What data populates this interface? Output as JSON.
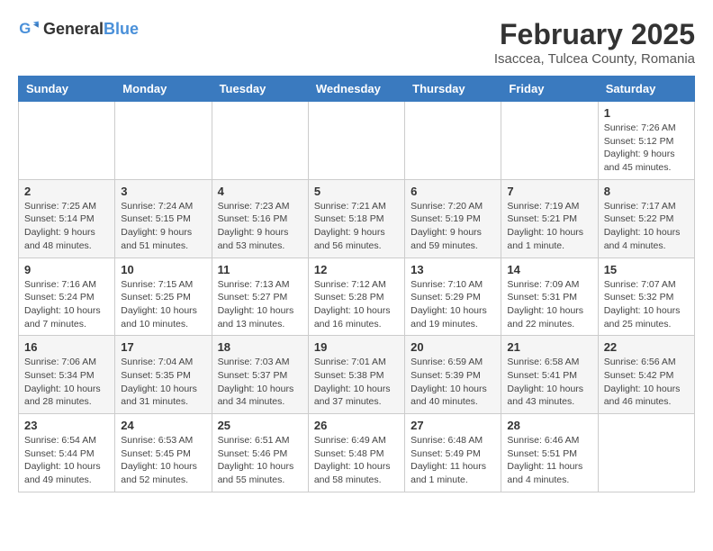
{
  "app": {
    "logo_general": "General",
    "logo_blue": "Blue"
  },
  "header": {
    "title": "February 2025",
    "subtitle": "Isaccea, Tulcea County, Romania"
  },
  "calendar": {
    "weekdays": [
      "Sunday",
      "Monday",
      "Tuesday",
      "Wednesday",
      "Thursday",
      "Friday",
      "Saturday"
    ],
    "weeks": [
      [
        {
          "day": "",
          "info": ""
        },
        {
          "day": "",
          "info": ""
        },
        {
          "day": "",
          "info": ""
        },
        {
          "day": "",
          "info": ""
        },
        {
          "day": "",
          "info": ""
        },
        {
          "day": "",
          "info": ""
        },
        {
          "day": "1",
          "info": "Sunrise: 7:26 AM\nSunset: 5:12 PM\nDaylight: 9 hours and 45 minutes."
        }
      ],
      [
        {
          "day": "2",
          "info": "Sunrise: 7:25 AM\nSunset: 5:14 PM\nDaylight: 9 hours and 48 minutes."
        },
        {
          "day": "3",
          "info": "Sunrise: 7:24 AM\nSunset: 5:15 PM\nDaylight: 9 hours and 51 minutes."
        },
        {
          "day": "4",
          "info": "Sunrise: 7:23 AM\nSunset: 5:16 PM\nDaylight: 9 hours and 53 minutes."
        },
        {
          "day": "5",
          "info": "Sunrise: 7:21 AM\nSunset: 5:18 PM\nDaylight: 9 hours and 56 minutes."
        },
        {
          "day": "6",
          "info": "Sunrise: 7:20 AM\nSunset: 5:19 PM\nDaylight: 9 hours and 59 minutes."
        },
        {
          "day": "7",
          "info": "Sunrise: 7:19 AM\nSunset: 5:21 PM\nDaylight: 10 hours and 1 minute."
        },
        {
          "day": "8",
          "info": "Sunrise: 7:17 AM\nSunset: 5:22 PM\nDaylight: 10 hours and 4 minutes."
        }
      ],
      [
        {
          "day": "9",
          "info": "Sunrise: 7:16 AM\nSunset: 5:24 PM\nDaylight: 10 hours and 7 minutes."
        },
        {
          "day": "10",
          "info": "Sunrise: 7:15 AM\nSunset: 5:25 PM\nDaylight: 10 hours and 10 minutes."
        },
        {
          "day": "11",
          "info": "Sunrise: 7:13 AM\nSunset: 5:27 PM\nDaylight: 10 hours and 13 minutes."
        },
        {
          "day": "12",
          "info": "Sunrise: 7:12 AM\nSunset: 5:28 PM\nDaylight: 10 hours and 16 minutes."
        },
        {
          "day": "13",
          "info": "Sunrise: 7:10 AM\nSunset: 5:29 PM\nDaylight: 10 hours and 19 minutes."
        },
        {
          "day": "14",
          "info": "Sunrise: 7:09 AM\nSunset: 5:31 PM\nDaylight: 10 hours and 22 minutes."
        },
        {
          "day": "15",
          "info": "Sunrise: 7:07 AM\nSunset: 5:32 PM\nDaylight: 10 hours and 25 minutes."
        }
      ],
      [
        {
          "day": "16",
          "info": "Sunrise: 7:06 AM\nSunset: 5:34 PM\nDaylight: 10 hours and 28 minutes."
        },
        {
          "day": "17",
          "info": "Sunrise: 7:04 AM\nSunset: 5:35 PM\nDaylight: 10 hours and 31 minutes."
        },
        {
          "day": "18",
          "info": "Sunrise: 7:03 AM\nSunset: 5:37 PM\nDaylight: 10 hours and 34 minutes."
        },
        {
          "day": "19",
          "info": "Sunrise: 7:01 AM\nSunset: 5:38 PM\nDaylight: 10 hours and 37 minutes."
        },
        {
          "day": "20",
          "info": "Sunrise: 6:59 AM\nSunset: 5:39 PM\nDaylight: 10 hours and 40 minutes."
        },
        {
          "day": "21",
          "info": "Sunrise: 6:58 AM\nSunset: 5:41 PM\nDaylight: 10 hours and 43 minutes."
        },
        {
          "day": "22",
          "info": "Sunrise: 6:56 AM\nSunset: 5:42 PM\nDaylight: 10 hours and 46 minutes."
        }
      ],
      [
        {
          "day": "23",
          "info": "Sunrise: 6:54 AM\nSunset: 5:44 PM\nDaylight: 10 hours and 49 minutes."
        },
        {
          "day": "24",
          "info": "Sunrise: 6:53 AM\nSunset: 5:45 PM\nDaylight: 10 hours and 52 minutes."
        },
        {
          "day": "25",
          "info": "Sunrise: 6:51 AM\nSunset: 5:46 PM\nDaylight: 10 hours and 55 minutes."
        },
        {
          "day": "26",
          "info": "Sunrise: 6:49 AM\nSunset: 5:48 PM\nDaylight: 10 hours and 58 minutes."
        },
        {
          "day": "27",
          "info": "Sunrise: 6:48 AM\nSunset: 5:49 PM\nDaylight: 11 hours and 1 minute."
        },
        {
          "day": "28",
          "info": "Sunrise: 6:46 AM\nSunset: 5:51 PM\nDaylight: 11 hours and 4 minutes."
        },
        {
          "day": "",
          "info": ""
        }
      ]
    ]
  }
}
